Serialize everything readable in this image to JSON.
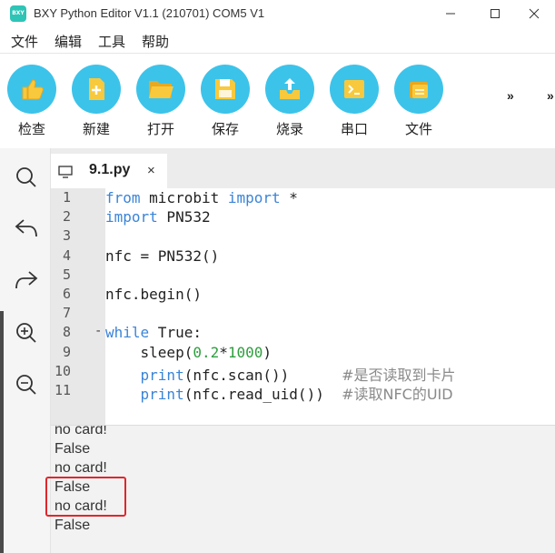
{
  "window": {
    "logo_text": "BXY",
    "title": "BXY Python Editor V1.1 (210701) COM5 V1",
    "logo_color": "#2ec4b6"
  },
  "menu": {
    "items": [
      "文件",
      "编辑",
      "工具",
      "帮助"
    ]
  },
  "toolbar": {
    "accent": "#3cc3ea",
    "buttons": [
      {
        "label": "检查",
        "icon": "thumbs-up-icon"
      },
      {
        "label": "新建",
        "icon": "new-file-icon"
      },
      {
        "label": "打开",
        "icon": "open-folder-icon"
      },
      {
        "label": "保存",
        "icon": "save-floppy-icon"
      },
      {
        "label": "烧录",
        "icon": "upload-tray-icon"
      },
      {
        "label": "串口",
        "icon": "terminal-icon"
      },
      {
        "label": "文件",
        "icon": "files-icon"
      }
    ],
    "overflow": [
      "»",
      "»"
    ]
  },
  "sidebar": {
    "tools": [
      "search-icon",
      "undo-icon",
      "redo-icon",
      "zoom-in-icon",
      "zoom-out-icon"
    ]
  },
  "tab": {
    "title": "9.1.py",
    "close": "×"
  },
  "editor": {
    "line_numbers": [
      "1",
      "2",
      "3",
      "4",
      "5",
      "6",
      "7",
      "8",
      "9",
      "10",
      "11"
    ],
    "fold_marker": "-",
    "lines": [
      {
        "parts": [
          {
            "t": "from",
            "c": "kw"
          },
          {
            "t": " microbit ",
            "c": ""
          },
          {
            "t": "import",
            "c": "kw"
          },
          {
            "t": " *",
            "c": ""
          }
        ]
      },
      {
        "parts": [
          {
            "t": "import",
            "c": "kw"
          },
          {
            "t": " PN532",
            "c": ""
          }
        ]
      },
      {
        "parts": []
      },
      {
        "parts": [
          {
            "t": "nfc = PN532()",
            "c": ""
          }
        ]
      },
      {
        "parts": []
      },
      {
        "parts": [
          {
            "t": "nfc.begin()",
            "c": ""
          }
        ]
      },
      {
        "parts": []
      },
      {
        "parts": [
          {
            "t": "while",
            "c": "kw"
          },
          {
            "t": " True:",
            "c": ""
          }
        ]
      },
      {
        "parts": [
          {
            "t": "    sleep(",
            "c": ""
          },
          {
            "t": "0.2",
            "c": "num"
          },
          {
            "t": "*",
            "c": ""
          },
          {
            "t": "1000",
            "c": "num"
          },
          {
            "t": ")",
            "c": ""
          }
        ]
      },
      {
        "parts": [
          {
            "t": "    ",
            "c": ""
          },
          {
            "t": "print",
            "c": "fn"
          },
          {
            "t": "(nfc.scan())      ",
            "c": ""
          },
          {
            "t": "#是否读取到卡片",
            "c": "cm"
          }
        ]
      },
      {
        "parts": [
          {
            "t": "    ",
            "c": ""
          },
          {
            "t": "print",
            "c": "fn"
          },
          {
            "t": "(nfc.read_uid())  ",
            "c": ""
          },
          {
            "t": "#读取NFC的UID",
            "c": "cm"
          }
        ]
      }
    ]
  },
  "console": {
    "lines": [
      "no card!",
      "False",
      "no card!",
      "False",
      "no card!",
      "False"
    ]
  }
}
